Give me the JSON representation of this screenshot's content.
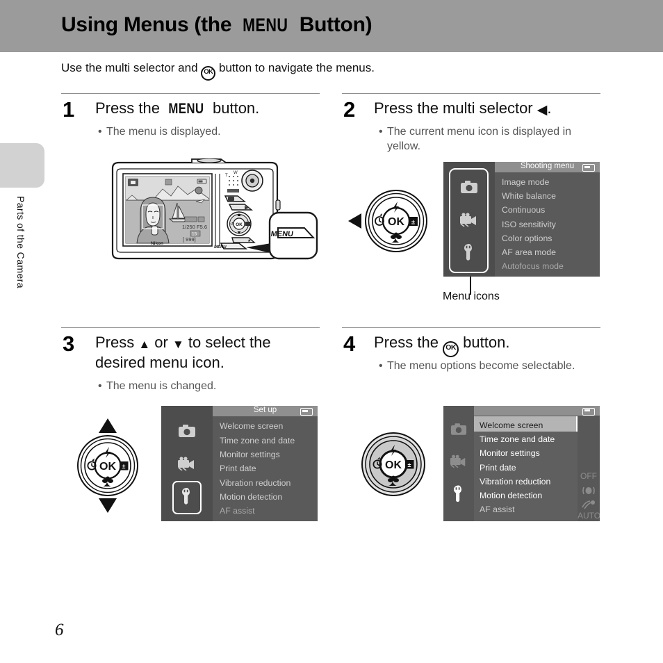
{
  "header": {
    "title_before": "Using Menus (the ",
    "title_menu_word": "MENU",
    "title_after": " Button)",
    "bar_color": "#9b9b9b"
  },
  "side_tab": {
    "label": "Parts of the Camera"
  },
  "intro": {
    "text_before": "Use the multi selector and ",
    "ok_glyph": "OK",
    "text_after": " button to navigate the menus."
  },
  "page": {
    "number": "6"
  },
  "steps": [
    {
      "number": "1",
      "title_before": "Press the ",
      "title_menu_word": "MENU",
      "title_after": " button.",
      "bullets": [
        "The menu is displayed."
      ],
      "figure": "camera-rear-illustration"
    },
    {
      "number": "2",
      "title_before": "Press the multi selector ",
      "title_arrow": "◀",
      "title_after": ".",
      "bullets": [
        "The current menu icon is displayed in",
        "yellow."
      ],
      "figure": "shooting-menu-screen",
      "callout_label": "Menu icons"
    },
    {
      "number": "3",
      "title_line1_before": "Press ",
      "title_arrow_up": "▲",
      "title_mid": " or ",
      "title_arrow_down": "▼",
      "title_line1_after": " to select the",
      "title_line2": "desired menu icon.",
      "bullets": [
        "The menu is changed."
      ],
      "figure": "setup-menu-screen"
    },
    {
      "number": "4",
      "title_before": "Press the ",
      "title_ok": "OK",
      "title_after": " button.",
      "bullets": [
        "The menu options become selectable."
      ],
      "figure": "setup-menu-active-screen"
    }
  ],
  "shooting_menu": {
    "title": "Shooting menu",
    "items": [
      "Image mode",
      "White balance",
      "Continuous",
      "ISO sensitivity",
      "Color options",
      "AF area mode",
      "Autofocus mode"
    ],
    "icons": [
      "camera-icon",
      "movie-icon",
      "wrench-icon"
    ],
    "selected_icon": "camera-icon",
    "battery": "battery-icon",
    "bg_color": "#5a5a5a",
    "icon_col_color": "#4d4d4d",
    "title_bar_color": "#8f8f8f",
    "item_text_color": "#cfcfcf"
  },
  "setup_menu": {
    "title": "Set up",
    "items": [
      "Welcome screen",
      "Time zone and date",
      "Monitor settings",
      "Print date",
      "Vibration reduction",
      "Motion detection",
      "AF assist"
    ],
    "icons": [
      "camera-icon",
      "movie-icon",
      "wrench-icon"
    ],
    "selected_icon": "wrench-icon",
    "battery": "battery-icon"
  },
  "setup_menu_active": {
    "title": "",
    "items": [
      "Welcome screen",
      "Time zone and date",
      "Monitor settings",
      "Print date",
      "Vibration reduction",
      "Motion detection",
      "AF assist"
    ],
    "values": [
      "",
      "",
      "",
      "OFF",
      "vr-icon",
      "motion-icon",
      "AUTO"
    ],
    "highlighted_item": "Welcome screen",
    "icons": [
      "camera-icon",
      "movie-icon",
      "wrench-icon"
    ],
    "selected_icon": "wrench-icon",
    "battery": "battery-icon",
    "highlight_color": "#b4b4b4"
  },
  "multi_selector": {
    "up_icon": "flash-icon",
    "left_icon": "self-timer-icon",
    "right_icon": "exposure-compensation-icon",
    "down_icon": "macro-icon",
    "center_label": "OK"
  },
  "camera_illustration": {
    "brand": "Nikon",
    "menu_button_label": "MENU",
    "lcd_readout": [
      "999",
      "15",
      "1/250",
      "F5.6"
    ]
  }
}
